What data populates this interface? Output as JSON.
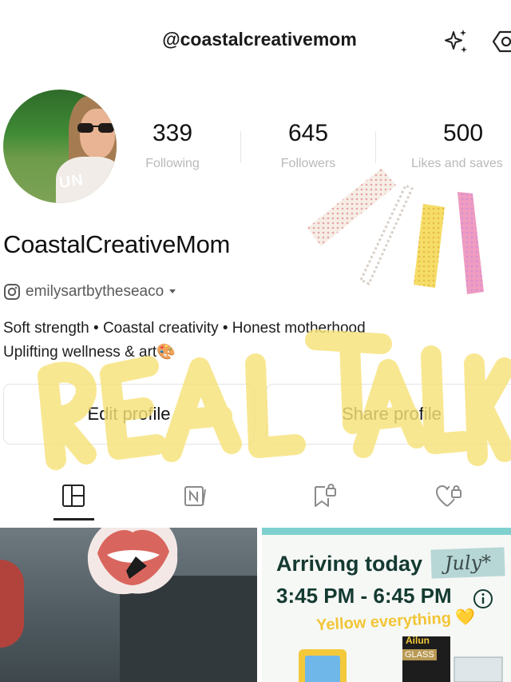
{
  "header": {
    "handle": "@coastalcreativemom",
    "icons": [
      "sparkle-icon",
      "settings-icon"
    ]
  },
  "profile": {
    "avatar_badge": "UN",
    "display_name": "CoastalCreativeMom",
    "instagram_handle": "emilysartbytheseaco",
    "bio_line1": "Soft strength • Coastal creativity • Honest motherhood",
    "bio_line2": "Uplifting wellness & art🎨"
  },
  "stats": [
    {
      "value": "339",
      "label": "Following"
    },
    {
      "value": "645",
      "label": "Followers"
    },
    {
      "value": "500",
      "label": "Likes and saves"
    }
  ],
  "buttons": {
    "edit_profile": "Edit profile",
    "share_profile": "Share profile"
  },
  "tabs": [
    {
      "name": "posts",
      "icon": "grid-icon",
      "selected": true
    },
    {
      "name": "notes",
      "icon": "notes-icon",
      "selected": false
    },
    {
      "name": "collections",
      "icon": "bookmark-lock-icon",
      "selected": false
    },
    {
      "name": "liked",
      "icon": "heart-lock-icon",
      "selected": false
    }
  ],
  "posts": [
    {
      "type": "photo",
      "sticker": "lips-sticker"
    },
    {
      "arriving": "Arriving today",
      "month_tag": "July*",
      "time_range": "3:45 PM - 6:45 PM",
      "note": "Yellow everything 💛",
      "products": [
        "Ailun",
        "GLASS"
      ]
    }
  ],
  "overlay": {
    "text": "REAL TALK",
    "color": "#f7e27a"
  },
  "colors": {
    "accent_teal": "#7fd1cf",
    "amazon_text": "#143a31",
    "muted_label": "#b9b9b9"
  }
}
